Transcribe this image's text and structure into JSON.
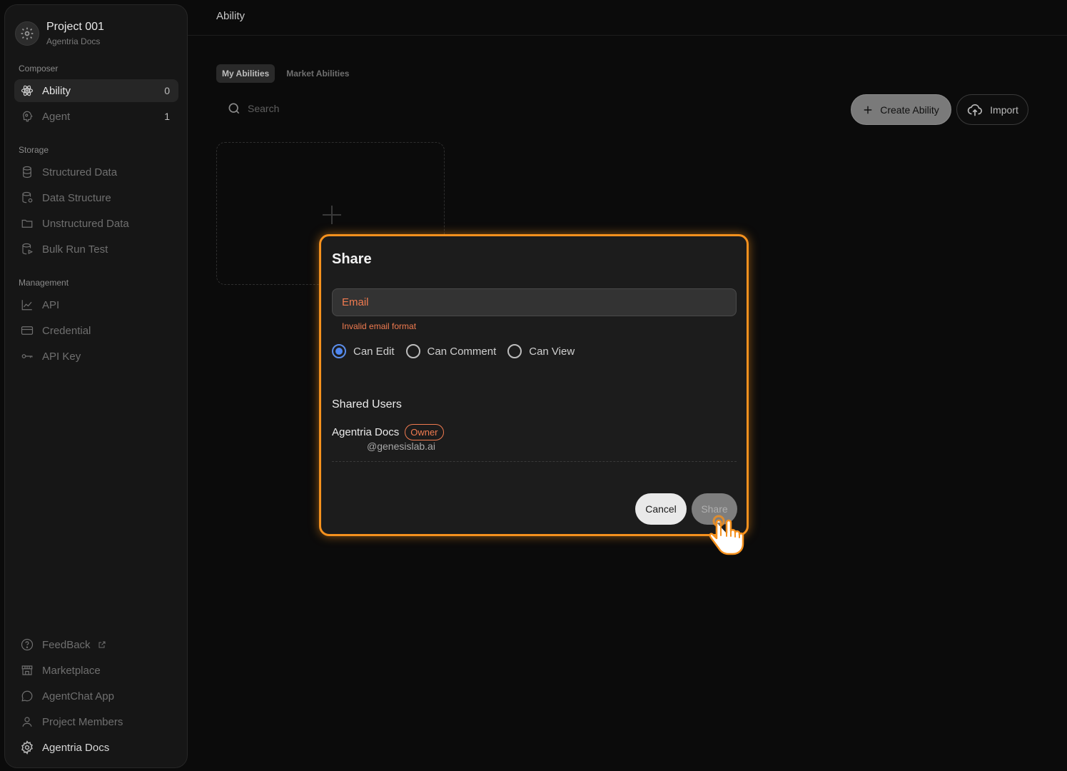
{
  "sidebar": {
    "project_title": "Project 001",
    "project_subtitle": "Agentria Docs",
    "sections": {
      "composer": "Composer",
      "storage": "Storage",
      "management": "Management"
    },
    "composer_items": [
      {
        "label": "Ability",
        "count": "0",
        "icon": "atom-icon"
      },
      {
        "label": "Agent",
        "count": "1",
        "icon": "brain-icon"
      }
    ],
    "storage_items": [
      {
        "label": "Structured Data",
        "icon": "database-icon"
      },
      {
        "label": "Data Structure",
        "icon": "database-gear-icon"
      },
      {
        "label": "Unstructured Data",
        "icon": "folder-icon"
      },
      {
        "label": "Bulk Run Test",
        "icon": "database-play-icon"
      }
    ],
    "management_items": [
      {
        "label": "API",
        "icon": "chart-line-icon"
      },
      {
        "label": "Credential",
        "icon": "card-icon"
      },
      {
        "label": "API Key",
        "icon": "key-icon"
      }
    ],
    "bottom_items": [
      {
        "label": "FeedBack",
        "icon": "help-circle-icon"
      },
      {
        "label": "Marketplace",
        "icon": "store-icon"
      },
      {
        "label": "AgentChat App",
        "icon": "chat-icon"
      },
      {
        "label": "Project Members",
        "icon": "user-icon"
      },
      {
        "label": "Agentria Docs",
        "icon": "gear-icon"
      }
    ]
  },
  "main": {
    "title": "Ability",
    "tabs": [
      {
        "label": "My Abilities",
        "active": true
      },
      {
        "label": "Market Abilities",
        "active": false
      }
    ],
    "search_placeholder": "Search",
    "create_label": "Create Ability",
    "import_label": "Import"
  },
  "modal": {
    "title": "Share",
    "email_placeholder": "Email",
    "error": "Invalid email format",
    "permissions": [
      {
        "label": "Can Edit",
        "selected": true
      },
      {
        "label": "Can Comment",
        "selected": false
      },
      {
        "label": "Can View",
        "selected": false
      }
    ],
    "shared_users_title": "Shared Users",
    "user_name": "Agentria Docs",
    "user_badge": "Owner",
    "user_email": "@genesislab.ai",
    "cancel_label": "Cancel",
    "share_label": "Share"
  },
  "colors": {
    "accent_orange": "#f5911e",
    "error_red": "#f07b50",
    "radio_blue": "#4f86ef"
  }
}
